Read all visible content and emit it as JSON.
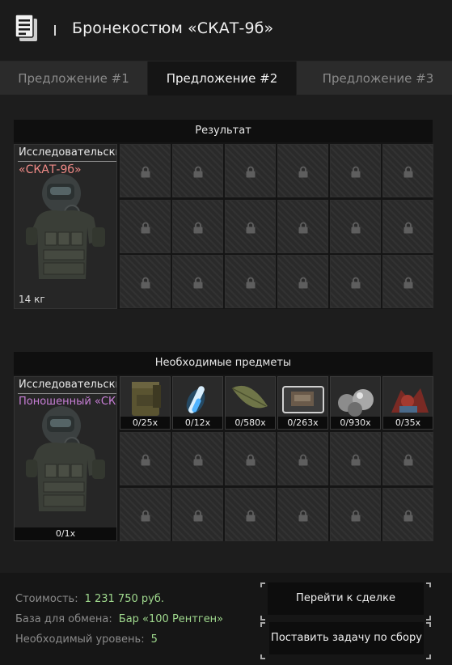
{
  "header": {
    "title": "Бронекостюм «СКАТ-9б»",
    "icon": "document-icon"
  },
  "tabs": [
    {
      "label": "Предложение #1",
      "active": false
    },
    {
      "label": "Предложение #2",
      "active": true
    },
    {
      "label": "Предложение #3",
      "active": false
    }
  ],
  "result": {
    "title": "Результат",
    "item": {
      "name_line1": "Исследовательские",
      "name_line2": "«СКАТ-9б»",
      "name_color": "#f08a86",
      "weight": "14 кг"
    },
    "locked_slots": 18
  },
  "required": {
    "title": "Необходимые предметы",
    "main_item": {
      "name_line1": "Исследовательские",
      "name_line2": "Поношенный «СК..",
      "name_color": "#c97fd8",
      "count": "0/1x"
    },
    "items": [
      {
        "icon": "ammo-box-icon",
        "count": "0/25x"
      },
      {
        "icon": "glowing-vial-icon",
        "count": "0/12x"
      },
      {
        "icon": "leaf-icon",
        "count": "0/580x"
      },
      {
        "icon": "device-case-icon",
        "count": "0/263x"
      },
      {
        "icon": "metal-spheres-icon",
        "count": "0/930x"
      },
      {
        "icon": "red-artifact-icon",
        "count": "0/35x"
      }
    ],
    "locked_slots": 12
  },
  "footer": {
    "cost_label": "Стоимость:",
    "cost_value": "1 231 750 руб.",
    "base_label": "База для обмена:",
    "base_value": "Бар «100 Рентген»",
    "level_label": "Необходимый уровень:",
    "level_value": "5",
    "value_color": "#9fd88d",
    "go_to_deal_button": "Перейти к сделке",
    "assemble_task_button": "Поставить задачу по сбору"
  }
}
